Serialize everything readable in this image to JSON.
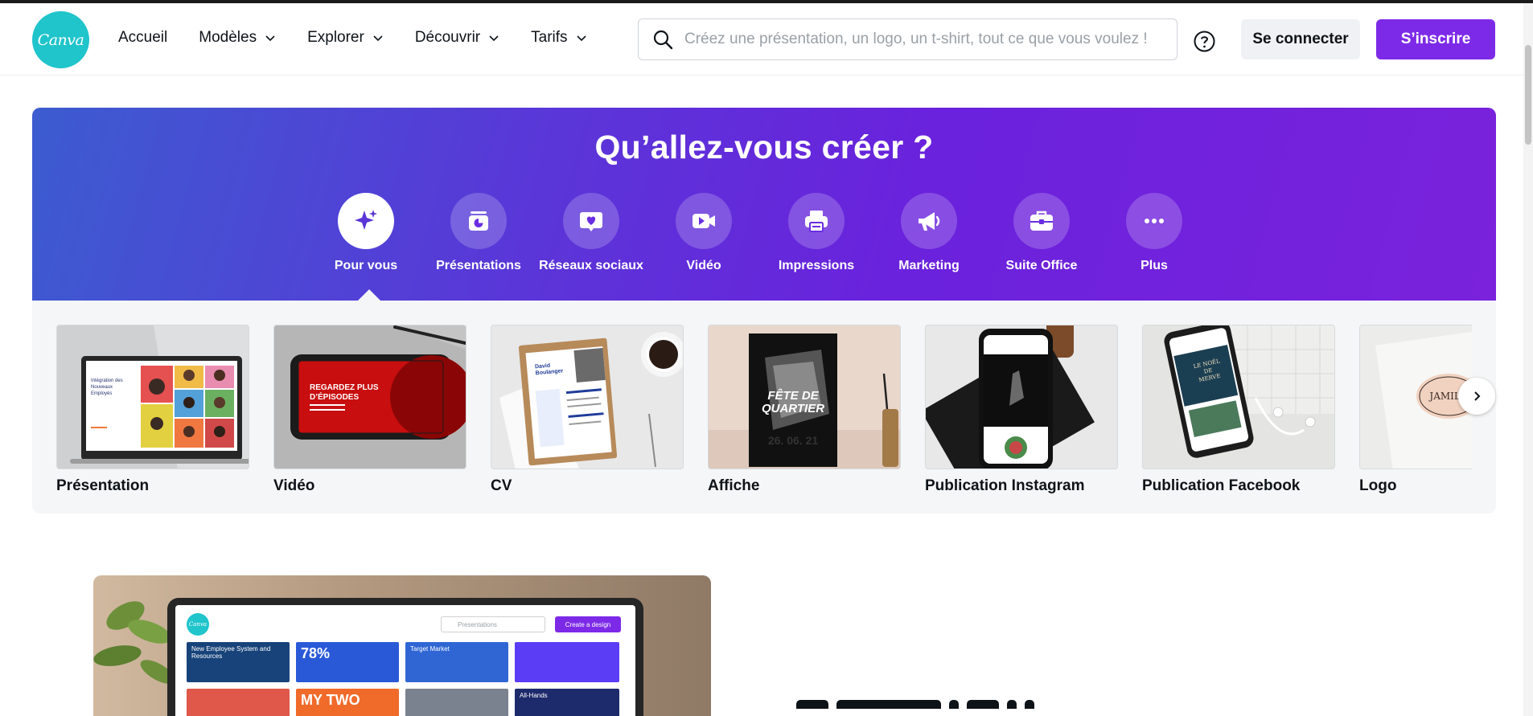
{
  "header": {
    "logo_text": "Canva",
    "nav": [
      {
        "label": "Accueil",
        "dropdown": false
      },
      {
        "label": "Modèles",
        "dropdown": true
      },
      {
        "label": "Explorer",
        "dropdown": true
      },
      {
        "label": "Découvrir",
        "dropdown": true
      },
      {
        "label": "Tarifs",
        "dropdown": true
      }
    ],
    "search_placeholder": "Créez une présentation, un logo, un t-shirt, tout ce que vous voulez !",
    "help_icon": "question-circle-icon",
    "login_label": "Se connecter",
    "signup_label": "S’inscrire"
  },
  "hero": {
    "title": "Qu’allez-vous créer ?",
    "categories": [
      {
        "label": "Pour vous",
        "icon": "sparkle-icon",
        "active": true
      },
      {
        "label": "Présentations",
        "icon": "presentation-icon",
        "active": false
      },
      {
        "label": "Réseaux sociaux",
        "icon": "heart-chat-icon",
        "active": false
      },
      {
        "label": "Vidéo",
        "icon": "video-camera-icon",
        "active": false
      },
      {
        "label": "Impressions",
        "icon": "printer-icon",
        "active": false
      },
      {
        "label": "Marketing",
        "icon": "megaphone-icon",
        "active": false
      },
      {
        "label": "Suite Office",
        "icon": "briefcase-icon",
        "active": false
      },
      {
        "label": "Plus",
        "icon": "more-dots-icon",
        "active": false
      }
    ]
  },
  "cards": [
    {
      "title": "Présentation",
      "thumb_text": [
        "Intégration des",
        "Nouveaux",
        "Employés"
      ]
    },
    {
      "title": "Vidéo",
      "thumb_text": [
        "REGARDEZ PLUS",
        "D’ÉPISODES"
      ]
    },
    {
      "title": "CV",
      "thumb_text": [
        "David",
        "Boulanger"
      ]
    },
    {
      "title": "Affiche",
      "thumb_text": [
        "FÊTE DE",
        "QUARTIER",
        "26. 06. 21"
      ]
    },
    {
      "title": "Publication Instagram",
      "thumb_text": []
    },
    {
      "title": "Publication Facebook",
      "thumb_text": [
        "LE NOËL",
        "DE",
        "MERVE"
      ]
    },
    {
      "title": "Logo",
      "thumb_text": [
        "JAMILA"
      ]
    }
  ],
  "preview": {
    "logo_text": "Canva",
    "search_placeholder": "Presentations",
    "button_label": "Create a design",
    "tiles": [
      {
        "text": "New Employee System and Resources",
        "color": "#17437a"
      },
      {
        "text": "78%",
        "color": "#2a59d8"
      },
      {
        "text": "Target Market",
        "color": "#2f66d4"
      },
      {
        "text": "",
        "color": "#5b3df5"
      },
      {
        "text": "",
        "color": "#e0584a"
      },
      {
        "text": "MY TWO",
        "color": "#f06a2a"
      },
      {
        "text": "",
        "color": "#7a8290"
      },
      {
        "text": "All-Hands",
        "color": "#1d2a6b"
      }
    ]
  },
  "colors": {
    "brand_teal": "#20c4cb",
    "brand_purple": "#7d2ae8"
  }
}
